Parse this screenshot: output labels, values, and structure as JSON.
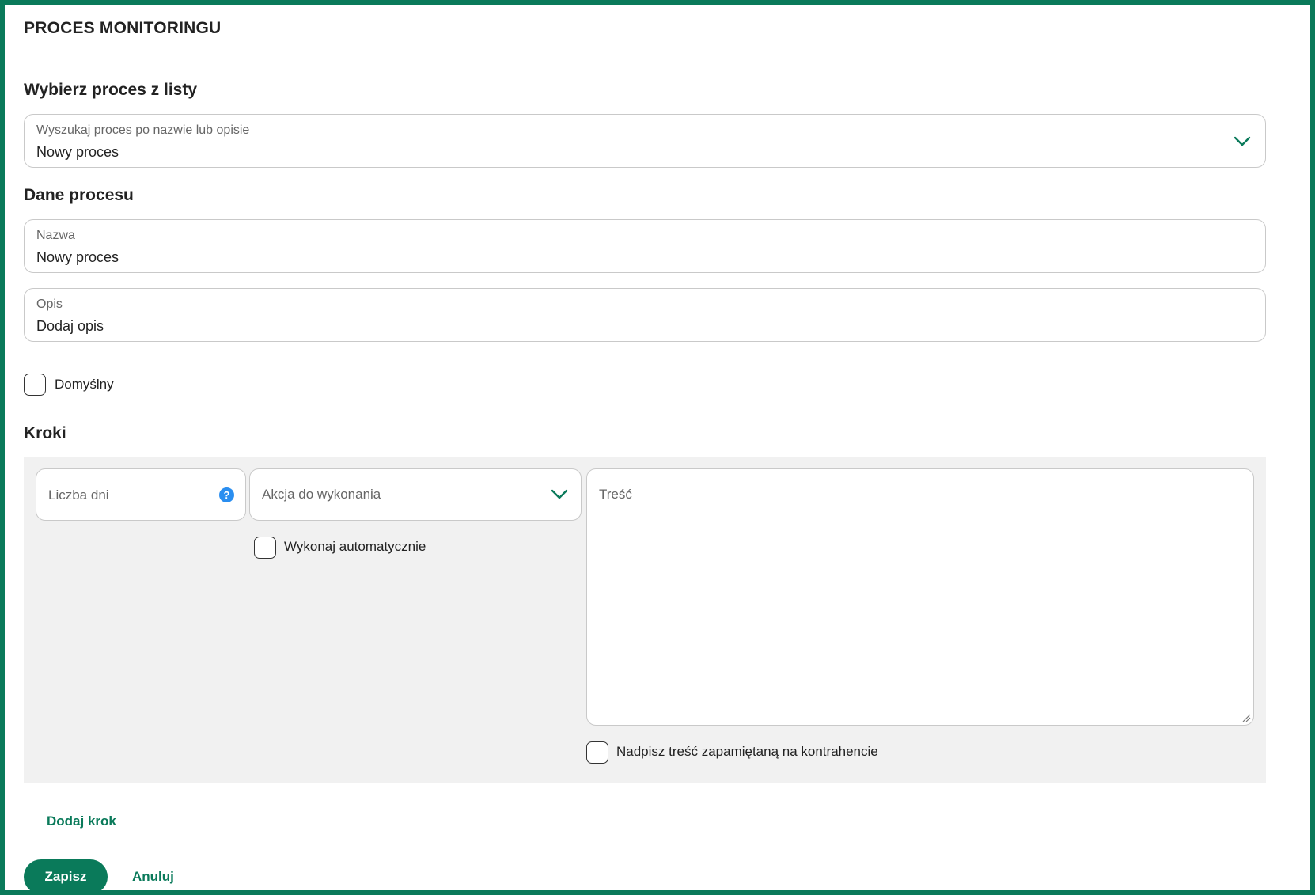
{
  "page": {
    "title": "PROCES MONITORINGU"
  },
  "select_process": {
    "heading": "Wybierz proces z listy",
    "label": "Wyszukaj proces po nazwie lub opisie",
    "value": "Nowy proces"
  },
  "process_data": {
    "heading": "Dane procesu",
    "name_label": "Nazwa",
    "name_value": "Nowy proces",
    "description_label": "Opis",
    "description_value": "Dodaj opis",
    "default_checkbox_label": "Domyślny"
  },
  "steps": {
    "heading": "Kroki",
    "days_placeholder": "Liczba dni",
    "help_glyph": "?",
    "action_placeholder": "Akcja do wykonania",
    "auto_execute_label": "Wykonaj automatycznie",
    "content_placeholder": "Treść",
    "override_label": "Nadpisz treść zapamiętaną na kontrahencie",
    "add_step_label": "Dodaj krok"
  },
  "actions": {
    "save_label": "Zapisz",
    "cancel_label": "Anuluj"
  },
  "colors": {
    "accent": "#0a7a5a",
    "help_icon": "#2a8ef0",
    "panel_bg": "#f1f1f1"
  }
}
